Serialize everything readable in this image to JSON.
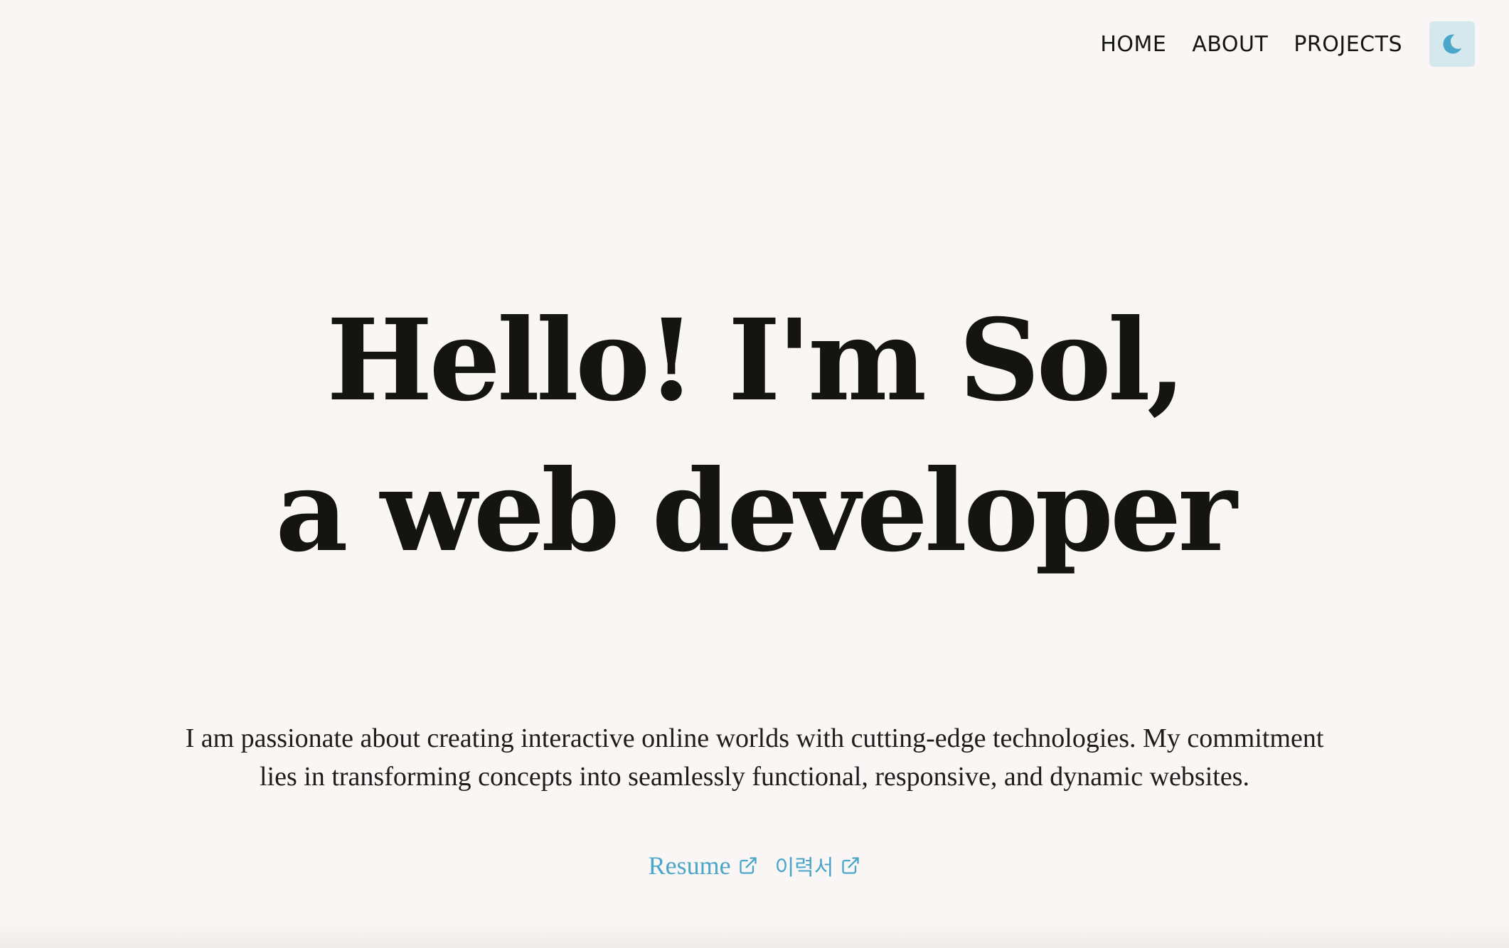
{
  "nav": {
    "items": [
      {
        "label": "HOME"
      },
      {
        "label": "ABOUT"
      },
      {
        "label": "PROJECTS"
      }
    ],
    "theme_toggle": {
      "icon": "moon-icon"
    }
  },
  "hero": {
    "title_line1": "Hello! I'm Sol,",
    "title_line2": "a web developer"
  },
  "intro": {
    "line1": "I am passionate about creating interactive online worlds with cutting-edge technologies. My commitment",
    "line2": "lies in transforming concepts into seamlessly functional, responsive, and dynamic websites."
  },
  "links": {
    "resume": {
      "label": "Resume",
      "icon": "external-link-icon"
    },
    "resume_ko": {
      "label": "이력서",
      "icon": "external-link-icon"
    }
  },
  "colors": {
    "background": "#faf6f5",
    "text": "#141412",
    "accent": "#4aa7c9",
    "toggle_bg": "#d4e8ed"
  }
}
